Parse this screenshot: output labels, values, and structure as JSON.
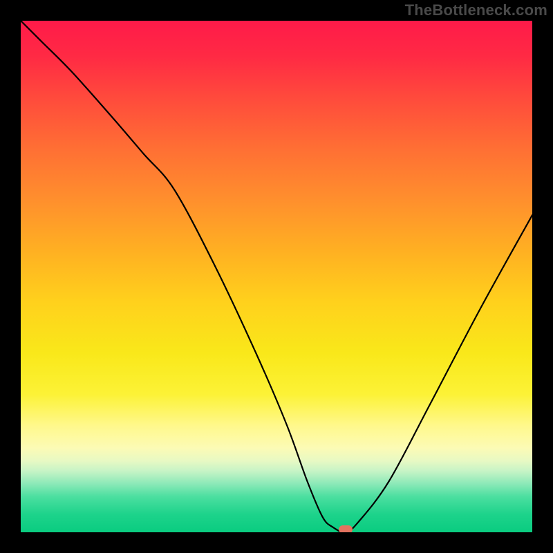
{
  "watermark": "TheBottleneck.com",
  "chart_data": {
    "type": "line",
    "title": "",
    "xlabel": "",
    "ylabel": "",
    "xlim": [
      0,
      100
    ],
    "ylim": [
      0,
      100
    ],
    "grid": false,
    "series": [
      {
        "name": "bottleneck-curve",
        "x": [
          0,
          4,
          10,
          18,
          24,
          30,
          38,
          46,
          52,
          56,
          59,
          61,
          63.5,
          66,
          72,
          80,
          90,
          100
        ],
        "y": [
          100,
          96,
          90,
          81,
          74,
          67,
          52,
          35,
          21,
          10,
          3,
          1,
          0,
          2,
          10,
          25,
          44,
          62
        ],
        "stroke": "#000000",
        "stroke_width": 2
      }
    ],
    "marker": {
      "x": 63.5,
      "y": 0.5,
      "color": "#e2735f"
    },
    "background_gradient": {
      "direction": "vertical",
      "stops": [
        {
          "pct": 0,
          "color": "#ff1a49"
        },
        {
          "pct": 15,
          "color": "#ff4a3c"
        },
        {
          "pct": 35,
          "color": "#ff8f2d"
        },
        {
          "pct": 55,
          "color": "#ffd11c"
        },
        {
          "pct": 73,
          "color": "#fcf236"
        },
        {
          "pct": 86,
          "color": "#e8f9c3"
        },
        {
          "pct": 93,
          "color": "#4cdfa0"
        },
        {
          "pct": 100,
          "color": "#0acc80"
        }
      ]
    }
  }
}
